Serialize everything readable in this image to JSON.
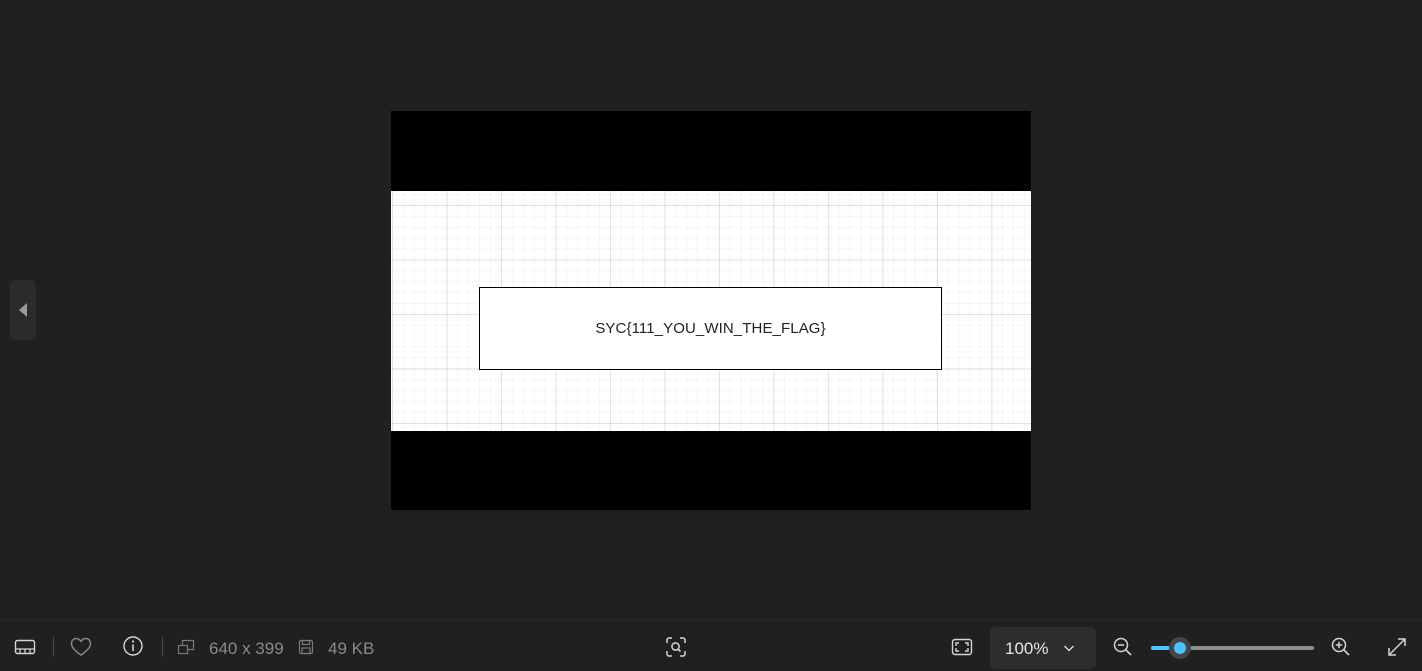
{
  "image": {
    "flag_text": "SYC{111_YOU_WIN_THE_FLAG}"
  },
  "toolbar": {
    "dimensions": "640 x 399",
    "file_size": "49 KB",
    "zoom_label": "100%",
    "zoom_slider_fraction": 0.18
  },
  "icons": {
    "previous": "chevron-left-icon",
    "filmstrip": "filmstrip-icon",
    "favorite": "heart-icon",
    "info": "info-icon",
    "dimensions": "resize-icon",
    "file_size": "save-icon",
    "visual_search": "visual-search-icon",
    "fit_to_window": "fit-to-window-icon",
    "zoom_dropdown": "chevron-down-icon",
    "zoom_out": "zoom-out-icon",
    "zoom_in": "zoom-in-icon",
    "fullscreen": "fullscreen-icon"
  },
  "colors": {
    "background": "#202020",
    "accent": "#4cc2ff"
  }
}
